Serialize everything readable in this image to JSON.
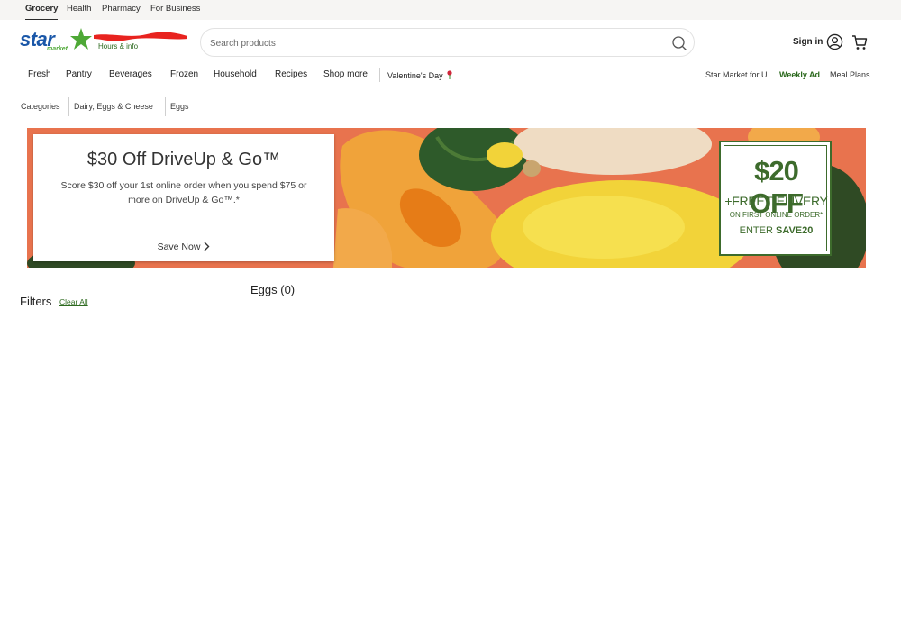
{
  "utility_tabs": [
    {
      "label": "Grocery",
      "active": true
    },
    {
      "label": "Health",
      "active": false
    },
    {
      "label": "Pharmacy",
      "active": false
    },
    {
      "label": "For Business",
      "active": false
    }
  ],
  "brand": {
    "logo_text": "star",
    "logo_sub": "market",
    "primary_color": "#1a57a8",
    "accent_color": "#4ea836"
  },
  "store": {
    "hours_link": "Hours & info"
  },
  "search": {
    "placeholder": "Search products",
    "value": ""
  },
  "account": {
    "signin_label": "Sign in"
  },
  "nav": {
    "items": [
      "Fresh",
      "Pantry",
      "Beverages",
      "Frozen",
      "Household",
      "Recipes",
      "Shop more"
    ],
    "seasonal": "Valentine's Day",
    "right_links": [
      "Star Market for U",
      "Weekly Ad",
      "Meal Plans"
    ]
  },
  "breadcrumb": [
    "Categories",
    "Dairy, Eggs & Cheese",
    "Eggs"
  ],
  "banner": {
    "title": "$30 Off DriveUp & Go™",
    "description": "Score $30 off your 1st online order when you spend $75 or more on DriveUp & Go™.*",
    "cta": "Save Now",
    "background_color": "#e8734e",
    "coupon": {
      "amount": "$20 OFF",
      "line1": "+FREE DELIVERY",
      "line2": "ON FIRST ONLINE ORDER*",
      "line3_prefix": "ENTER",
      "code": "SAVE20",
      "color": "#3d6b2c"
    }
  },
  "filters": {
    "title": "Filters",
    "clear_label": "Clear All"
  },
  "results": {
    "label": "Eggs (0)"
  }
}
